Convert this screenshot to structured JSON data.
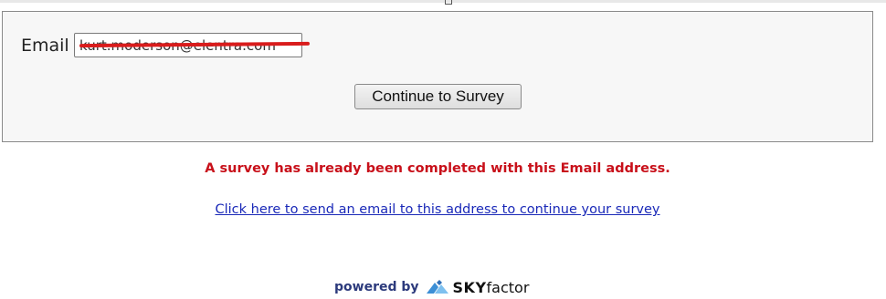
{
  "form": {
    "email_label": "Email",
    "email_value": "kurt.moderson@elentra.com",
    "continue_label": "Continue to Survey"
  },
  "messages": {
    "error": "A survey has already been completed with this Email address.",
    "resend_link": "Click here to send an email to this address to continue your survey"
  },
  "footer": {
    "powered_by": "powered by",
    "brand_sky": "SKY",
    "brand_factor": "factor"
  },
  "colors": {
    "error": "#c8101a",
    "link": "#1a29b8",
    "redaction": "#d91c1c",
    "logo_blue": "#3c8fd6"
  },
  "icons": {
    "logo": "skyfactor-logo-icon"
  }
}
